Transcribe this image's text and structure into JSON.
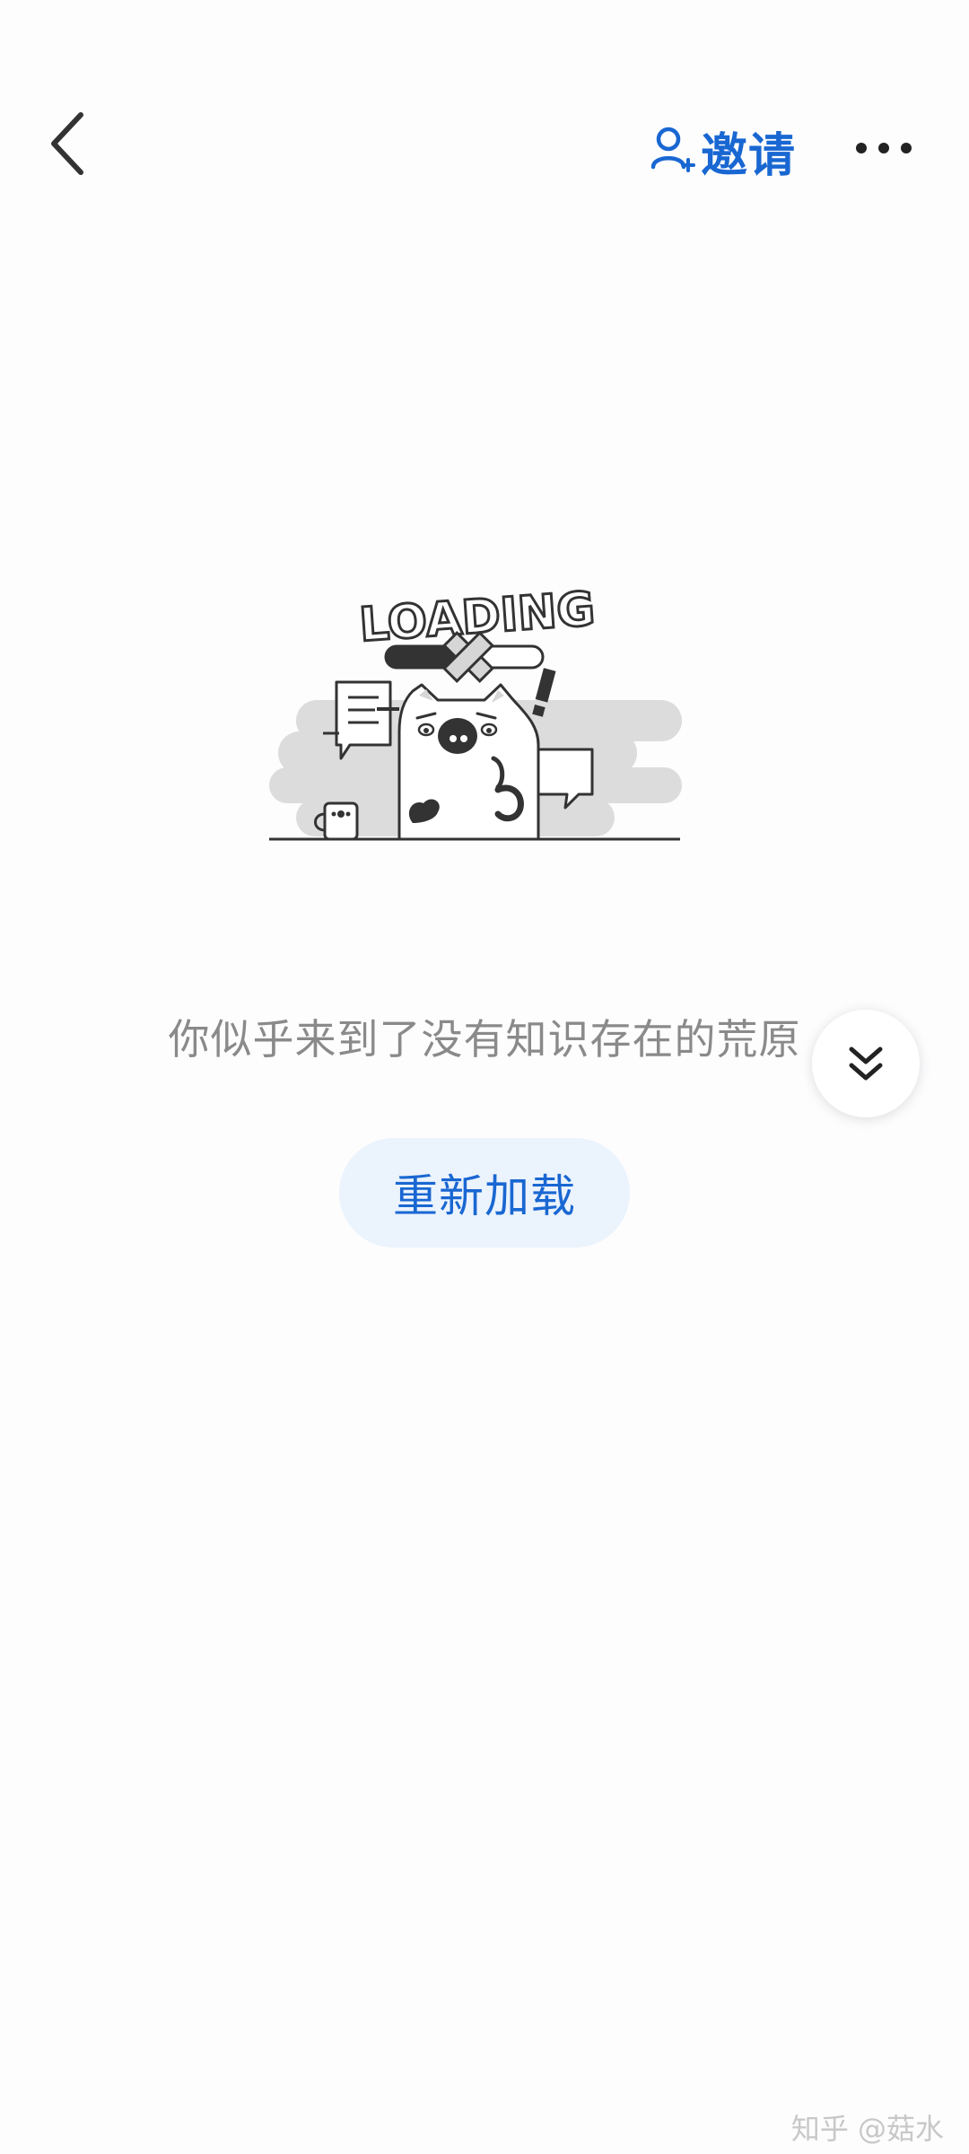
{
  "header": {
    "back_icon": "chevron-left-icon",
    "invite_icon": "add-user-icon",
    "invite_label": "邀请",
    "more_icon": "more-horizontal-icon",
    "accent_color": "#1967d2"
  },
  "empty_state": {
    "illustration_text": "LOADING",
    "message": "你似乎来到了没有知识存在的荒原",
    "reload_label": "重新加载"
  },
  "fab": {
    "icon": "double-chevron-down-icon"
  },
  "watermark": {
    "text": "知乎 @菇水"
  }
}
